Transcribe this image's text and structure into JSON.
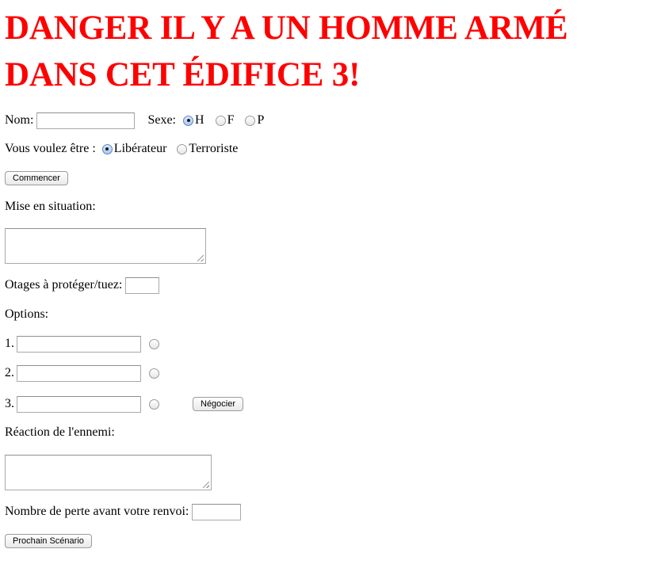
{
  "page": {
    "title": "DANGER IL Y A UN HOMME ARMÉ DANS CET ÉDIFICE 3!",
    "title_color": "#ff0000"
  },
  "identity": {
    "name_label": "Nom:",
    "name_value": "",
    "sex_label": "Sexe:",
    "sex_options": [
      {
        "label": "H",
        "checked": true
      },
      {
        "label": "F",
        "checked": false
      },
      {
        "label": "P",
        "checked": false
      }
    ]
  },
  "role": {
    "label": "Vous voulez être :",
    "options": [
      {
        "label": "Libérateur",
        "checked": true
      },
      {
        "label": "Terroriste",
        "checked": false
      }
    ]
  },
  "start_button": "Commencer",
  "situation": {
    "label": "Mise en situation:",
    "value": ""
  },
  "hostages": {
    "label": "Otages à protéger/tuez:",
    "value": ""
  },
  "options": {
    "label": "Options:",
    "items": [
      {
        "number": "1.",
        "value": "",
        "checked": false
      },
      {
        "number": "2.",
        "value": "",
        "checked": false
      },
      {
        "number": "3.",
        "value": "",
        "checked": false
      }
    ],
    "negotiate_button": "Négocier"
  },
  "enemy_reaction": {
    "label": "Réaction de l'ennemi:",
    "value": ""
  },
  "losses": {
    "label": "Nombre de perte avant votre renvoi:",
    "value": ""
  },
  "next_button": "Prochain Scénario"
}
